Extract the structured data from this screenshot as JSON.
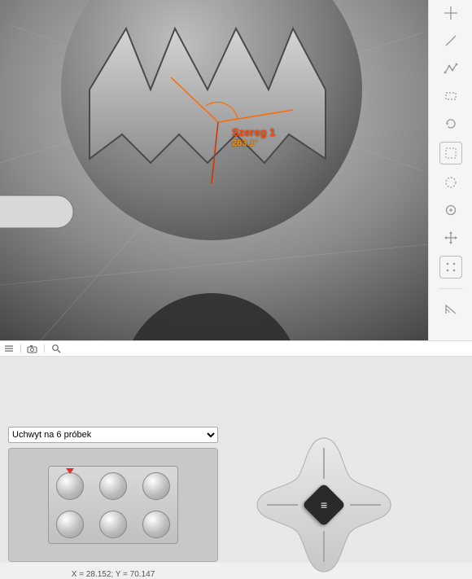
{
  "measurement": {
    "series_label": "Szereg 1",
    "angle_value": "263.1°"
  },
  "tabbar": {
    "list_tooltip": "Lista",
    "camera_tooltip": "Kamera",
    "search_tooltip": "Szukaj"
  },
  "tools": {
    "items": [
      {
        "name": "crosshair-icon"
      },
      {
        "name": "diagonal-icon"
      },
      {
        "name": "polyline-icon"
      },
      {
        "name": "rect-select-icon"
      },
      {
        "name": "rotate-icon"
      },
      {
        "name": "bounds-icon",
        "boxed": true
      },
      {
        "name": "circle-icon"
      },
      {
        "name": "aperture-icon"
      },
      {
        "name": "move-icon"
      },
      {
        "name": "grid-dots-icon",
        "boxed": true
      },
      {
        "name": "sep"
      },
      {
        "name": "angle-icon"
      }
    ]
  },
  "holder": {
    "selected": "Uchwyt na 6 próbek",
    "options": [
      "Uchwyt na 6 próbek"
    ],
    "active_index": 0,
    "coords_label": "X = 28.152; Y = 70.147"
  },
  "dpad": {
    "center_glyph": "≡"
  }
}
